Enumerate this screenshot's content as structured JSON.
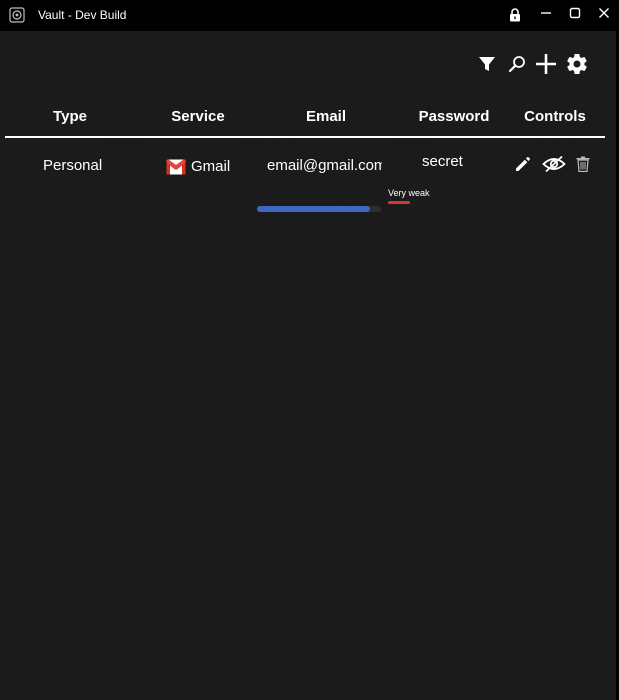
{
  "window": {
    "title": "Vault - Dev Build",
    "icons": {
      "app": "vault-app-icon",
      "lock": "lock-icon",
      "minimize": "minimize-icon",
      "maximize": "maximize-icon",
      "close": "close-icon"
    }
  },
  "toolbar": {
    "icons": [
      "filter-icon",
      "search-icon",
      "plus-icon",
      "gear-icon"
    ]
  },
  "table": {
    "headers": {
      "type": "Type",
      "service": "Service",
      "email": "Email",
      "password": "Password",
      "controls": "Controls"
    },
    "rows": [
      {
        "type": "Personal",
        "service": "Gmail",
        "service_icon": "gmail-icon",
        "email": "email@gmail.com",
        "password": "secret",
        "strength_label": "Very weak",
        "strength_fraction": 0.2,
        "email_scroll_fraction": 0.91,
        "controls": [
          "edit-icon",
          "eye-hidden-icon",
          "trash-icon"
        ]
      }
    ]
  },
  "colors": {
    "background": "#1c1c1c",
    "titlebar": "#000000",
    "accent_blue": "#3f68c2",
    "strength_weak": "#d23a3a",
    "gmail_red": "#d93025"
  }
}
